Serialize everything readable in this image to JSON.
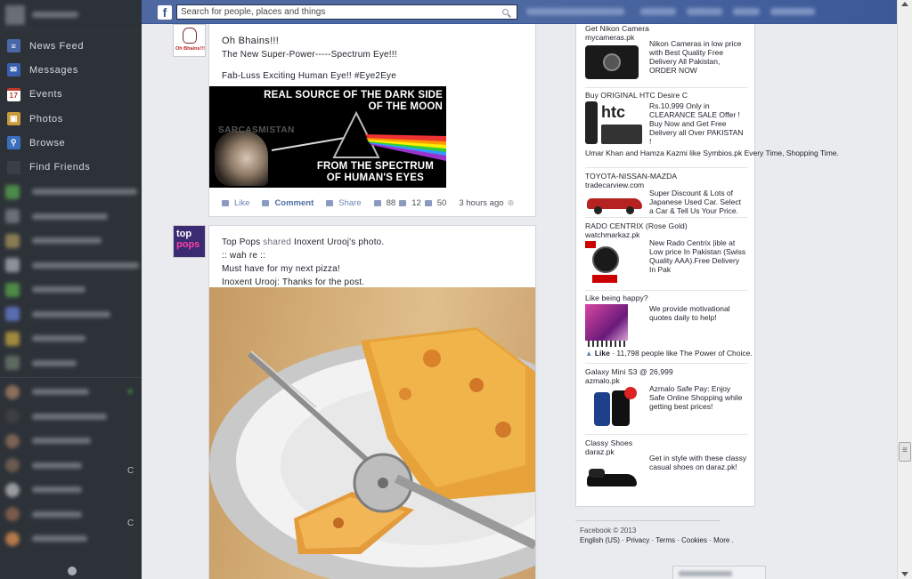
{
  "topbar": {
    "logo": "f",
    "search_placeholder": "Search for people, places and things"
  },
  "sidebar": {
    "items": [
      {
        "label": "News Feed"
      },
      {
        "label": "Messages"
      },
      {
        "label": "Events",
        "badge": "17"
      },
      {
        "label": "Photos"
      },
      {
        "label": "Browse"
      },
      {
        "label": "Find Friends"
      }
    ],
    "chat_counts": [
      "C",
      "C"
    ]
  },
  "story1": {
    "title": "Oh Bhains!!!",
    "line1": "The New Super-Power-----Spectrum Eye!!!",
    "line2": "Fab-Luss Exciting Human Eye!! #Eye2Eye",
    "image_top": "REAL SOURCE OF THE DARK SIDE\nOF THE MOON",
    "image_bottom": "FROM THE SPECTRUM\nOF HUMAN'S EYES",
    "image_watermark": "SARCASMISTAN",
    "avatar_label": "Oh Bhains!!!",
    "actions": {
      "like": "Like",
      "comment": "Comment",
      "share": "Share",
      "likes": "88",
      "comments": "12",
      "shares": "50",
      "time": "3 hours ago"
    }
  },
  "story2": {
    "page": "Top Pops",
    "verb": "shared",
    "owner": "Inoxent Urooj",
    "suffix": "'s photo.",
    "avatar_text_1": "top",
    "avatar_text_2": "pops",
    "line1": ":: wah re ::",
    "line2": "Must have for my next pizza!",
    "line3": "Inoxent Urooj: Thanks for the post."
  },
  "ads": [
    {
      "title": "Get Nikon Camera",
      "url": "mycameras.pk",
      "text": "Nikon Cameras in low price with Best Quality Free Delivery All Pakistan, ORDER NOW"
    },
    {
      "title": "Buy ORIGINAL HTC Desire C",
      "url": "",
      "text": "Rs.10,999 Only in CLEARANCE SALE Offer ! Buy Now and Get Free Delivery all Over PAKISTAN !",
      "social": "Umar Khan and Hamza Kazmi like Symbios.pk Every Time, Shopping Time."
    },
    {
      "title": "TOYOTA-NISSAN-MAZDA",
      "url": "tradecarview.com",
      "text": "Super Discount & Lots of Japanese Used Car. Select a Car & Tell Us Your Price."
    },
    {
      "title": "RADO CENTRIX (Rose Gold)",
      "url": "watchmarkaz.pk",
      "text": "New Rado Centrix |ible at Low price In Pakistan (Swiss Quality AAA).Free Delivery In Pak"
    },
    {
      "title": "Like being happy?",
      "url": "",
      "text": "We provide motivational quotes daily to help!",
      "social_like": "Like",
      "social": " · 11,798 people like The Power of Choice."
    },
    {
      "title": "Galaxy Mini S3 @ 26,999",
      "url": "azmalo.pk",
      "text": "Azmalo Safe Pay: Enjoy Safe Online Shopping while getting best prices!"
    },
    {
      "title": "Classy Shoes",
      "url": "daraz.pk",
      "text": "Get in style with these classy casual shoes on daraz.pk!"
    }
  ],
  "footer": {
    "copyright": "Facebook © 2013",
    "links": "English (US) · Privacy · Terms · Cookies · More ."
  },
  "colors": {
    "topbar": "#4e69a2",
    "sidebar": "#2d3238",
    "link": "#516ea3"
  }
}
